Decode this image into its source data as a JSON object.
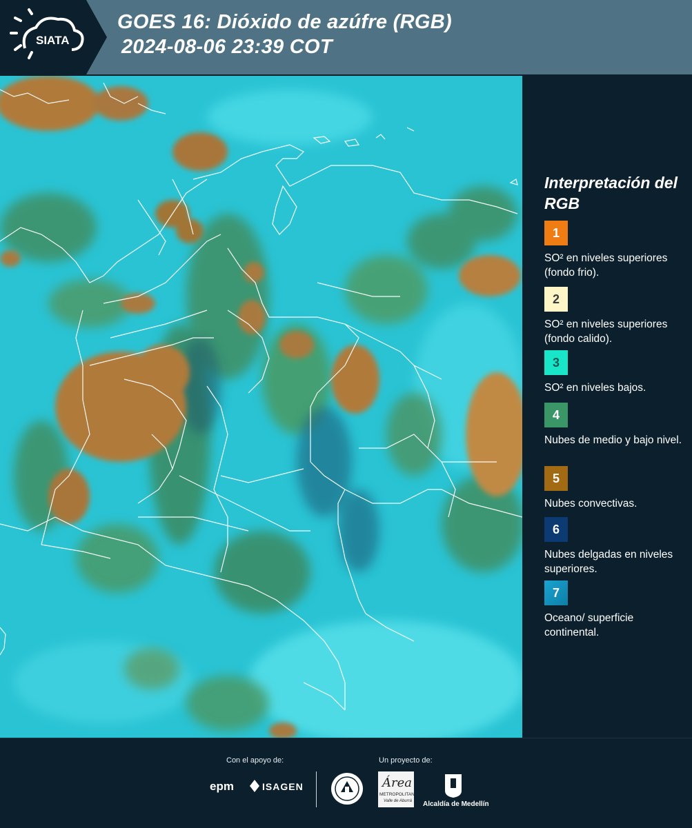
{
  "header": {
    "logo_text": "SIATA",
    "title_line1": "GOES 16: Dióxido de azúfre (RGB)",
    "title_line2": "2024-08-06 23:39 COT"
  },
  "map": {
    "colors": {
      "background_cyan": "#29c3d4",
      "light_cyan": "#5ee0ea",
      "cloud_green": "#3f8f63",
      "convective_brown": "#b07a3a",
      "border_white": "#ffffff"
    }
  },
  "legend": {
    "title": "Interpretación del RGB",
    "items": [
      {
        "number": "1",
        "label": "SO² en niveles superiores (fondo frio).",
        "color": "#f07d13",
        "text_color": "#ffffff"
      },
      {
        "number": "2",
        "label": "SO² en niveles superiores (fondo calido).",
        "color": "#fff6c8",
        "text_color": "#3a3a3a"
      },
      {
        "number": "3",
        "label": "SO² en niveles bajos.",
        "color": "#19e6c8",
        "text_color": "#1c5a53"
      },
      {
        "number": "4",
        "label": "Nubes de medio y bajo nivel.",
        "color": "#3a9567",
        "text_color": "#ffffff"
      },
      {
        "number": "5",
        "label": "Nubes convectivas.",
        "color": "#a26a12",
        "text_color": "#ffffff"
      },
      {
        "number": "6",
        "label": "Nubes delgadas en niveles superiores.",
        "color": "#0c3a72",
        "text_color": "#ffffff"
      },
      {
        "number": "7",
        "label": "Oceano/ superficie continental.",
        "color": "#1aa3cf",
        "text_color": "#ffffff"
      }
    ]
  },
  "footer": {
    "support_label": "Con el apoyo de:",
    "project_label": "Un proyecto de:",
    "epm": "epm",
    "isagen": "ISAGEN",
    "area_word": "Área",
    "area_sub1": "METROPOLITANA",
    "area_sub2": "Valle de Aburrá",
    "alcaldia": "Alcaldía de Medellín"
  }
}
